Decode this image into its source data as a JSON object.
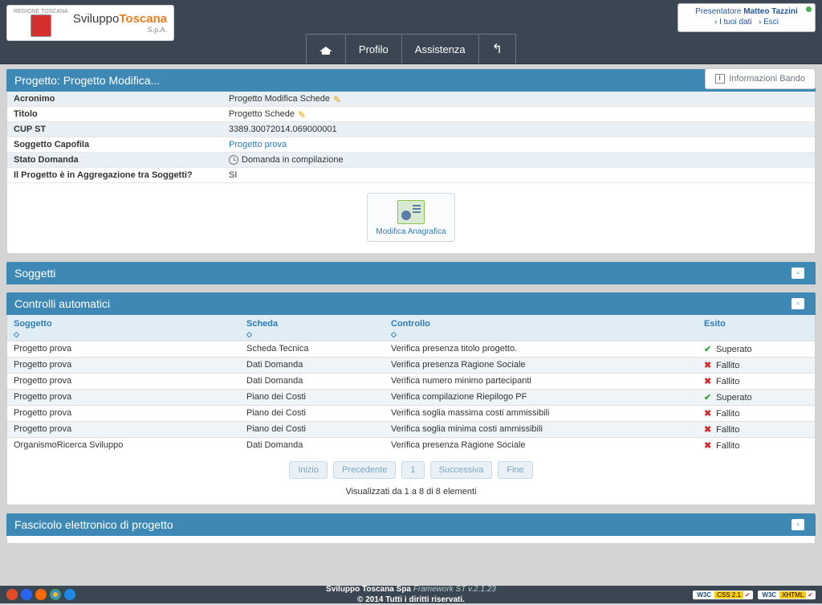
{
  "logo": {
    "region": "REGIONE TOSCANA",
    "brand_a": "Sviluppo",
    "brand_b": "Toscana",
    "spa": "S.p.A."
  },
  "user": {
    "role": "Presentatore",
    "name": "Matteo Tazzini",
    "link_dati": "› I tuoi dati",
    "link_esci": "› Esci"
  },
  "nav": {
    "profilo": "Profilo",
    "assistenza": "Assistenza"
  },
  "info_bando": "Informazioni Bando",
  "project_header": "Progetto: Progetto Modifica...",
  "details": {
    "rows": [
      {
        "label": "Acronimo",
        "value": "Progetto Modifica Schede",
        "edit": true
      },
      {
        "label": "Titolo",
        "value": "Progetto Schede",
        "edit": true
      },
      {
        "label": "CUP ST",
        "value": "3389.30072014.069000001"
      },
      {
        "label": "Soggetto Capofila",
        "value": "Progetto prova",
        "link": true
      },
      {
        "label": "Stato Domanda",
        "value": "Domanda in compilazione",
        "clock": true
      },
      {
        "label": "Il Progetto è in Aggregazione tra Soggetti?",
        "value": "SI"
      }
    ]
  },
  "anagrafica_label": "Modifica Anagrafica",
  "soggetti_header": "Soggetti",
  "controlli": {
    "header": "Controlli automatici",
    "th": {
      "soggetto": "Soggetto",
      "scheda": "Scheda",
      "controllo": "Controllo",
      "esito": "Esito"
    },
    "sort_glyph": "◇",
    "rows": [
      {
        "soggetto": "Progetto prova",
        "scheda": "Scheda Tecnica",
        "controllo": "Verifica presenza titolo progetto.",
        "esito": "Superato",
        "pass": true
      },
      {
        "soggetto": "Progetto prova",
        "scheda": "Dati Domanda",
        "controllo": "Verifica presenza Ragione Sociale",
        "esito": "Fallito",
        "pass": false
      },
      {
        "soggetto": "Progetto prova",
        "scheda": "Dati Domanda",
        "controllo": "Verifica numero minimo partecipanti",
        "esito": "Fallito",
        "pass": false
      },
      {
        "soggetto": "Progetto prova",
        "scheda": "Piano dei Costi",
        "controllo": "Verifica compilazione Riepilogo PF",
        "esito": "Superato",
        "pass": true
      },
      {
        "soggetto": "Progetto prova",
        "scheda": "Piano dei Costi",
        "controllo": "Verifica soglia massima costi ammissibili",
        "esito": "Fallito",
        "pass": false
      },
      {
        "soggetto": "Progetto prova",
        "scheda": "Piano dei Costi",
        "controllo": "Verifica soglia minima costi ammissibili",
        "esito": "Fallito",
        "pass": false
      },
      {
        "soggetto": "OrganismoRicerca Sviluppo",
        "scheda": "Dati Domanda",
        "controllo": "Verifica presenza Ragione Sociale",
        "esito": "Fallito",
        "pass": false
      }
    ]
  },
  "pagination": {
    "inizio": "Inizio",
    "precedente": "Precedente",
    "page": "1",
    "successiva": "Successiva",
    "fine": "Fine",
    "info": "Visualizzati da 1 a 8 di 8 elementi"
  },
  "fascicolo_header": "Fascicolo elettronico di progetto",
  "footer": {
    "line1a": "Sviluppo Toscana Spa ",
    "line1b": "Framework ST v.2.1.23",
    "line2": "© 2014 Tutti i diritti riservati.",
    "badge_css": "CSS 2.1",
    "badge_xhtml": "XHTML",
    "w3c": "W3C"
  }
}
